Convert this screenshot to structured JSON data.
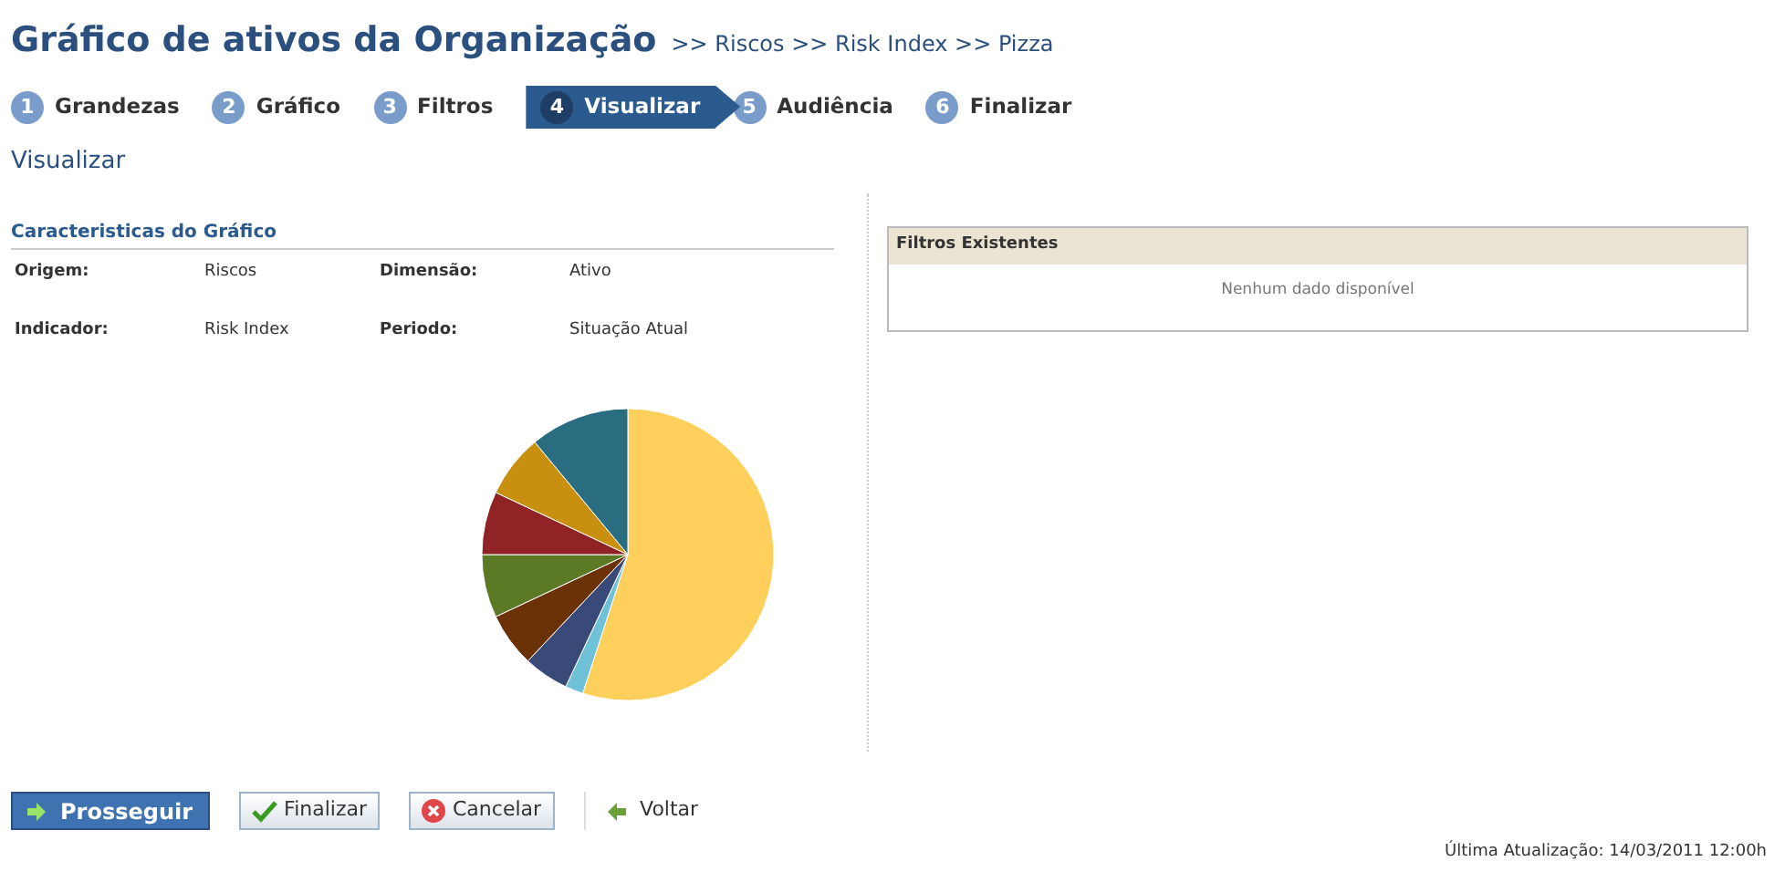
{
  "header": {
    "title": "Gráfico de ativos da Organização",
    "breadcrumb": ">> Riscos >> Risk Index >> Pizza"
  },
  "steps": [
    {
      "number": "1",
      "label": "Grandezas",
      "selected": false
    },
    {
      "number": "2",
      "label": "Gráfico",
      "selected": false
    },
    {
      "number": "3",
      "label": "Filtros",
      "selected": false
    },
    {
      "number": "4",
      "label": "Visualizar",
      "selected": true
    },
    {
      "number": "5",
      "label": "Audiência",
      "selected": false
    },
    {
      "number": "6",
      "label": "Finalizar",
      "selected": false
    }
  ],
  "section_title": "Visualizar",
  "characteristics": {
    "title": "Caracteristicas do Gráfico",
    "fields": [
      {
        "label": "Origem:",
        "value": "Riscos"
      },
      {
        "label": "Dimensão:",
        "value": "Ativo"
      },
      {
        "label": "Indicador:",
        "value": "Risk Index"
      },
      {
        "label": "Periodo:",
        "value": "Situação Atual"
      }
    ]
  },
  "filters": {
    "title": "Filtros Existentes",
    "empty": "Nenhum dado disponível"
  },
  "buttons": [
    {
      "kind": "primary",
      "label": "Prosseguir"
    },
    {
      "kind": "check",
      "label": "Finalizar"
    },
    {
      "kind": "cancel",
      "label": "Cancelar"
    },
    {
      "kind": "link",
      "label": "Voltar"
    }
  ],
  "footer": "Última Atualização: 14/03/2011 12:00h"
}
